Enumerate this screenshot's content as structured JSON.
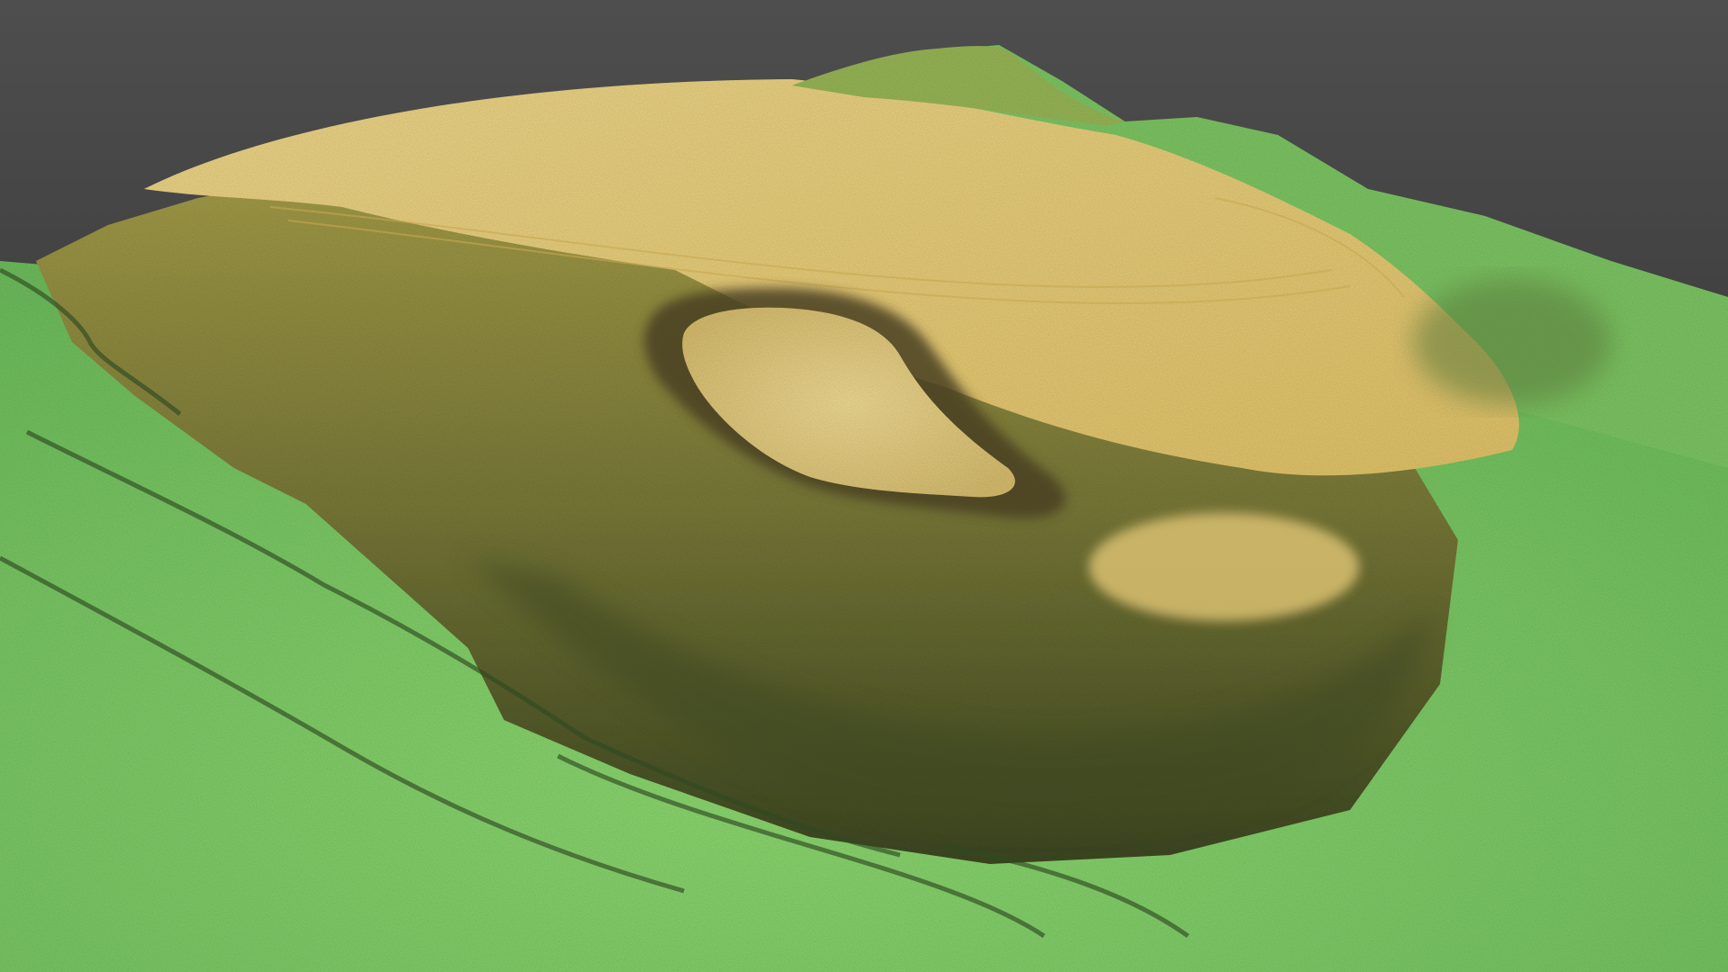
{
  "scene": {
    "subject": "hill-terrain-relief",
    "colors": {
      "background_top": "#4e4e4e",
      "background_bottom": "#262626",
      "lowland_green": "#6fbf5e",
      "bright_green": "#8fdb72",
      "slope_olive": "#7a7a3a",
      "dark_slope": "#3f4a24",
      "plateau_yellow": "#e3c56a",
      "plateau_highlight": "#f0d98c",
      "enclosure_interior": "#f2dd95",
      "rampart_shadow": "#4a4020"
    }
  }
}
